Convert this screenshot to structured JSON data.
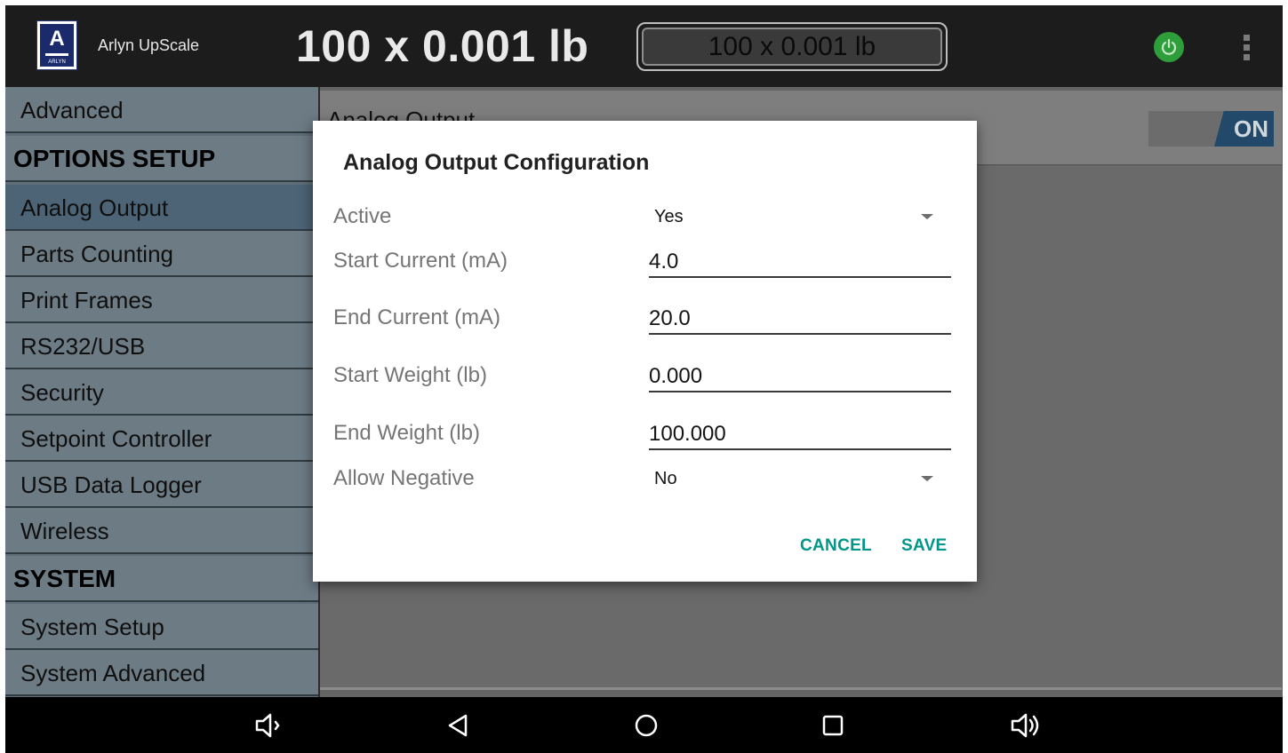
{
  "app": {
    "name": "Arlyn UpScale",
    "logo_letter": "A",
    "logo_text": "ARLYN"
  },
  "header": {
    "weight_display": "100 x 0.001 lb",
    "weight_box": "100 x 0.001 lb"
  },
  "sidebar": {
    "items": [
      {
        "label": "Advanced",
        "type": "item"
      },
      {
        "label": "OPTIONS SETUP",
        "type": "heading"
      },
      {
        "label": "Analog Output",
        "type": "item",
        "active": true
      },
      {
        "label": "Parts Counting",
        "type": "item"
      },
      {
        "label": "Print Frames",
        "type": "item"
      },
      {
        "label": "RS232/USB",
        "type": "item"
      },
      {
        "label": "Security",
        "type": "item"
      },
      {
        "label": "Setpoint Controller",
        "type": "item"
      },
      {
        "label": "USB Data Logger",
        "type": "item"
      },
      {
        "label": "Wireless",
        "type": "item"
      },
      {
        "label": "SYSTEM",
        "type": "heading"
      },
      {
        "label": "System Setup",
        "type": "item"
      },
      {
        "label": "System Advanced",
        "type": "item"
      }
    ]
  },
  "main": {
    "row_label": "Analog Output",
    "toggle_label": "ON"
  },
  "dialog": {
    "title": "Analog Output Configuration",
    "fields": [
      {
        "label": "Active",
        "value": "Yes",
        "kind": "select"
      },
      {
        "label": "Start Current (mA)",
        "value": "4.0",
        "kind": "text"
      },
      {
        "label": "End Current  (mA)",
        "value": "20.0",
        "kind": "text"
      },
      {
        "label": "Start Weight (lb)",
        "value": "0.000",
        "kind": "text"
      },
      {
        "label": "End Weight  (lb)",
        "value": "100.000",
        "kind": "text"
      },
      {
        "label": "Allow Negative",
        "value": "No",
        "kind": "select"
      }
    ],
    "cancel_label": "CANCEL",
    "save_label": "SAVE"
  },
  "colors": {
    "accent": "#00968a",
    "power": "#2e9e3a",
    "toggle_on": "#22486a",
    "sidebar_active": "#4c6476"
  },
  "navbar": {
    "icons": [
      "volume-down-icon",
      "back-icon",
      "home-icon",
      "recents-icon",
      "volume-up-icon"
    ]
  }
}
